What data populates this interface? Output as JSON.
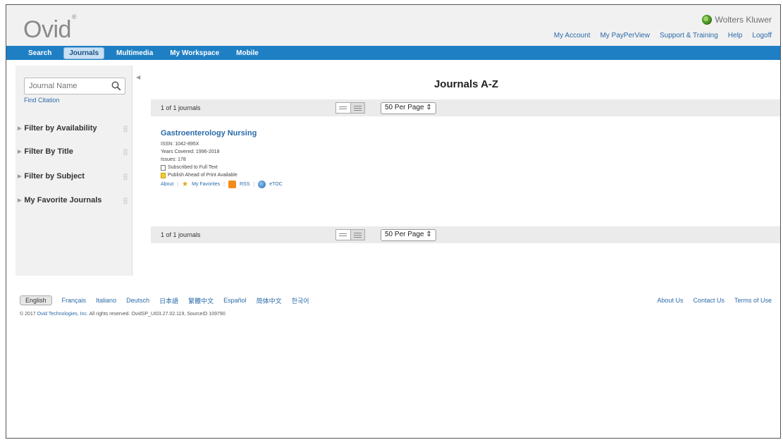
{
  "header": {
    "logo": "Ovid",
    "logo_mark": "®",
    "brand": "Wolters Kluwer",
    "links": [
      "My Account",
      "My PayPerView",
      "Support & Training",
      "Help",
      "Logoff"
    ]
  },
  "nav": {
    "tabs": [
      "Search",
      "Journals",
      "Multimedia",
      "My Workspace",
      "Mobile"
    ],
    "active": "Journals"
  },
  "sidebar": {
    "search_placeholder": "Journal Name",
    "find_citation": "Find Citation",
    "filters": [
      "Filter by Availability",
      "Filter By Title",
      "Filter by Subject",
      "My Favorite Journals"
    ]
  },
  "main": {
    "title": "Journals A-Z",
    "result_count": "1 of 1 journals",
    "per_page": "50  Per Page ⇕",
    "journal": {
      "title": "Gastroenterology Nursing",
      "issn": "ISSN: 1042-895X",
      "years": "Years Covered: 1996-2018",
      "issues": "Issues: 178",
      "subscribed": "Subscribed to Full Text",
      "ahead": "Publish Ahead of Print Available",
      "links": {
        "about": "About",
        "favorites": "My Favorites",
        "rss": "RSS",
        "etoc": "eTOC"
      }
    }
  },
  "footer": {
    "languages": [
      "English",
      "Français",
      "Italiano",
      "Deutsch",
      "日本語",
      "繁體中文",
      "Español",
      "简体中文",
      "한국어"
    ],
    "active_language": "English",
    "links": [
      "About Us",
      "Contact Us",
      "Terms of Use"
    ],
    "copyright_prefix": "© 2017",
    "copyright_link": "Ovid Technologies, Inc.",
    "copyright_suffix": "All rights reserved.   OvidSP_UI03.27.02.119, SourceID 109790"
  }
}
